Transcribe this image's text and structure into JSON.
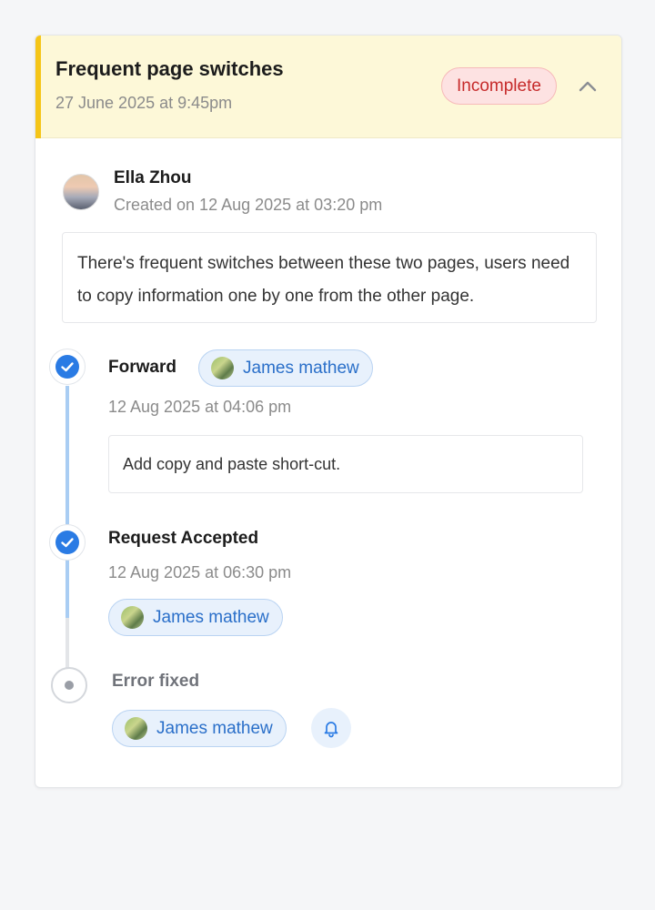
{
  "header": {
    "title": "Frequent page switches",
    "date": "27 June 2025 at 9:45pm",
    "status": "Incomplete",
    "collapse_icon": "chevron-up-icon",
    "accent_color": "#f5c518"
  },
  "issue": {
    "author": "Ella Zhou",
    "created": "Created on 12 Aug 2025 at 03:20 pm",
    "description": "There's frequent switches between these two pages, users need to copy information one by one from the other page."
  },
  "timeline": [
    {
      "title": "Forward",
      "assignee": "James mathew",
      "time": "12 Aug 2025 at 04:06 pm",
      "comment": "Add copy and paste short-cut.",
      "status": "done"
    },
    {
      "title": "Request Accepted",
      "time": "12 Aug 2025 at 06:30 pm",
      "assignee": "James mathew",
      "status": "done"
    },
    {
      "title": "Error fixed",
      "assignee": "James mathew",
      "status": "pending",
      "action_icon": "bell-icon"
    }
  ],
  "colors": {
    "primary": "#2a7be4",
    "timeline_line": "#a9cdf3",
    "badge_text": "#c62a2a"
  }
}
